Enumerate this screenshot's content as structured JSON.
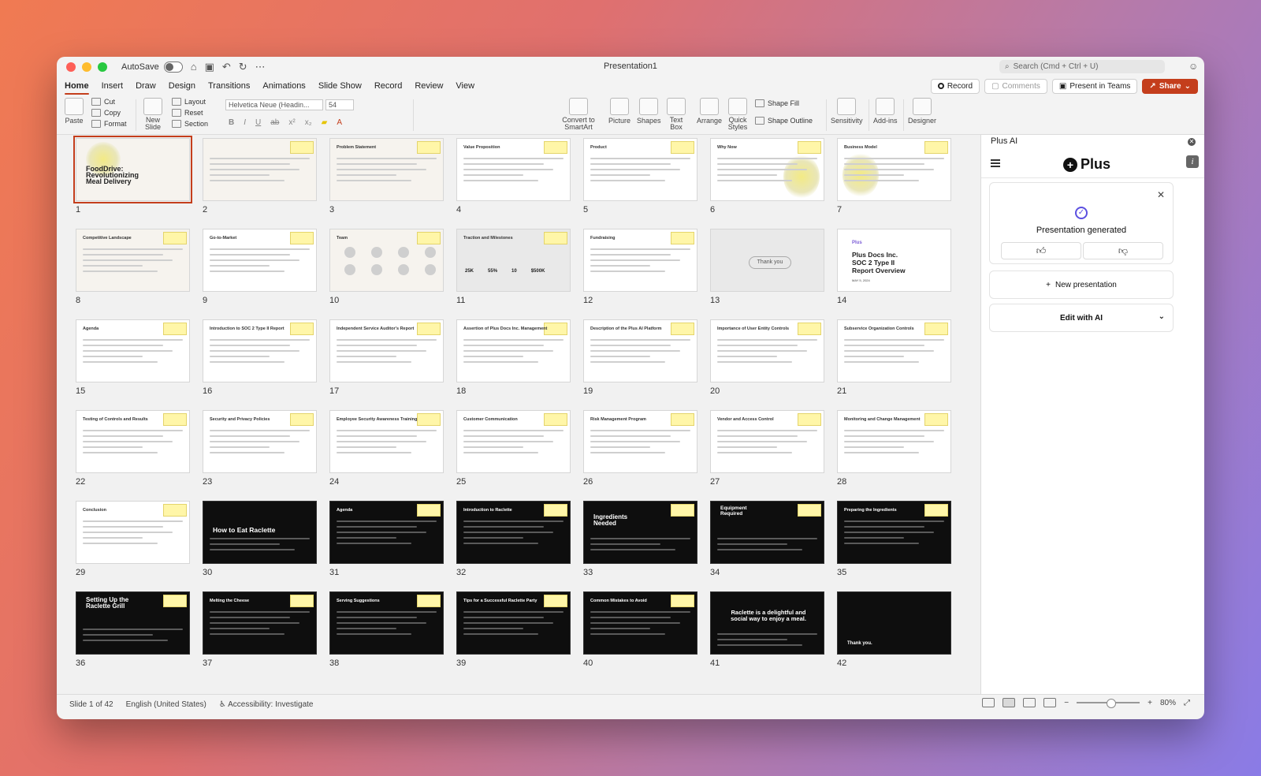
{
  "window": {
    "title": "Presentation1",
    "autosave_label": "AutoSave",
    "search_placeholder": "Search (Cmd + Ctrl + U)"
  },
  "tabs": [
    "Home",
    "Insert",
    "Draw",
    "Design",
    "Transitions",
    "Animations",
    "Slide Show",
    "Record",
    "Review",
    "View"
  ],
  "tab_buttons": {
    "record": "Record",
    "comments": "Comments",
    "present_teams": "Present in Teams",
    "share": "Share"
  },
  "ribbon": {
    "paste": "Paste",
    "cut": "Cut",
    "copy": "Copy",
    "format": "Format",
    "new_slide": "New Slide",
    "layout": "Layout",
    "reset": "Reset",
    "section": "Section",
    "font_name": "Helvetica Neue (Headin...",
    "font_size": "54",
    "convert_smartart": "Convert to SmartArt",
    "picture": "Picture",
    "shapes": "Shapes",
    "text_box": "Text Box",
    "arrange": "Arrange",
    "quick_styles": "Quick Styles",
    "shape_fill": "Shape Fill",
    "shape_outline": "Shape Outline",
    "sensitivity": "Sensitivity",
    "addins": "Add-ins",
    "designer": "Designer"
  },
  "slides": [
    {
      "n": "1",
      "title": "FoodDrive: Revolutionizing Meal Delivery"
    },
    {
      "n": "2",
      "title": ""
    },
    {
      "n": "3",
      "title": "Problem Statement"
    },
    {
      "n": "4",
      "title": "Value Proposition"
    },
    {
      "n": "5",
      "title": "Product"
    },
    {
      "n": "6",
      "title": "Why Now"
    },
    {
      "n": "7",
      "title": "Business Model"
    },
    {
      "n": "8",
      "title": "Competitive Landscape"
    },
    {
      "n": "9",
      "title": "Go-to-Market"
    },
    {
      "n": "10",
      "title": "Team"
    },
    {
      "n": "11",
      "title": "Traction and Milestones"
    },
    {
      "n": "12",
      "title": "Fundraising"
    },
    {
      "n": "13",
      "title": "Thank you"
    },
    {
      "n": "14",
      "title": "Plus Docs Inc. SOC 2 Type II Report Overview"
    },
    {
      "n": "15",
      "title": "Agenda"
    },
    {
      "n": "16",
      "title": "Introduction to SOC 2 Type II Report"
    },
    {
      "n": "17",
      "title": "Independent Service Auditor's Report"
    },
    {
      "n": "18",
      "title": "Assertion of Plus Docs Inc. Management"
    },
    {
      "n": "19",
      "title": "Description of the Plus AI Platform"
    },
    {
      "n": "20",
      "title": "Importance of User Entity Controls"
    },
    {
      "n": "21",
      "title": "Subservice Organization Controls"
    },
    {
      "n": "22",
      "title": "Testing of Controls and Results"
    },
    {
      "n": "23",
      "title": "Security and Privacy Policies"
    },
    {
      "n": "24",
      "title": "Employee Security Awareness Training"
    },
    {
      "n": "25",
      "title": "Customer Communication"
    },
    {
      "n": "26",
      "title": "Risk Management Program"
    },
    {
      "n": "27",
      "title": "Vendor and Access Control"
    },
    {
      "n": "28",
      "title": "Monitoring and Change Management"
    },
    {
      "n": "29",
      "title": "Conclusion"
    },
    {
      "n": "30",
      "title": "How to Eat Raclette"
    },
    {
      "n": "31",
      "title": "Agenda"
    },
    {
      "n": "32",
      "title": "Introduction to Raclette"
    },
    {
      "n": "33",
      "title": "Ingredients Needed"
    },
    {
      "n": "34",
      "title": "Equipment Required"
    },
    {
      "n": "35",
      "title": "Preparing the Ingredients"
    },
    {
      "n": "36",
      "title": "Setting Up the Raclette Grill"
    },
    {
      "n": "37",
      "title": "Melting the Cheese"
    },
    {
      "n": "38",
      "title": "Serving Suggestions"
    },
    {
      "n": "39",
      "title": "Tips for a Successful Raclette Party"
    },
    {
      "n": "40",
      "title": "Common Mistakes to Avoid"
    },
    {
      "n": "41",
      "title": "Raclette is a delightful and social way to enjoy a meal."
    },
    {
      "n": "42",
      "title": "Thank you."
    }
  ],
  "slide1": {
    "line1": "FoodDrive:",
    "line2": "Revolutionizing",
    "line3": "Meal Delivery"
  },
  "slide14": {
    "logo": "Plus",
    "line1": "Plus Docs Inc.",
    "line2": "SOC 2 Type II",
    "line3": "Report Overview",
    "date": "MAY 5, 2024"
  },
  "slide11_stats": [
    "25K",
    "55%",
    "10",
    "$500K"
  ],
  "panel": {
    "header": "Plus AI",
    "logo_text": "Plus",
    "generated": "Presentation generated",
    "new_presentation": "New presentation",
    "edit_ai": "Edit with AI"
  },
  "status": {
    "slide_of": "Slide 1 of 42",
    "language": "English (United States)",
    "accessibility": "Accessibility: Investigate",
    "zoom": "80%"
  }
}
